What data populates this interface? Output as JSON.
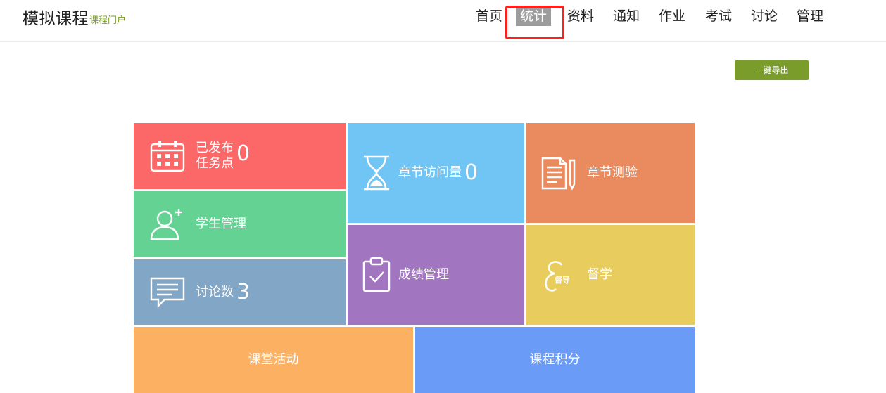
{
  "header": {
    "title": "模拟课程",
    "subtitle": "课程门户"
  },
  "nav": [
    {
      "label": "首页",
      "active": false
    },
    {
      "label": "统计",
      "active": true
    },
    {
      "label": "资料",
      "active": false
    },
    {
      "label": "通知",
      "active": false
    },
    {
      "label": "作业",
      "active": false
    },
    {
      "label": "考试",
      "active": false
    },
    {
      "label": "讨论",
      "active": false
    },
    {
      "label": "管理",
      "active": false
    }
  ],
  "toolbar": {
    "export_label": "一键导出"
  },
  "tiles": {
    "published": {
      "label_line1": "已发布",
      "label_line2": "任务点",
      "count": "0",
      "icon": "calendar-icon",
      "color": "#fc6767"
    },
    "students": {
      "label": "学生管理",
      "icon": "add-user-icon",
      "color": "#64d293"
    },
    "discussions": {
      "label": "讨论数",
      "count": "3",
      "icon": "chat-icon",
      "color": "#82a6c6"
    },
    "chapter_visits": {
      "label": "章节访问量",
      "count": "0",
      "icon": "hourglass-icon",
      "color": "#70c5f5"
    },
    "chapter_quiz": {
      "label": "章节测验",
      "icon": "document-pen-icon",
      "color": "#ea8a5f"
    },
    "grades": {
      "label": "成绩管理",
      "icon": "clipboard-check-icon",
      "color": "#a175bf"
    },
    "supervise": {
      "label": "督学",
      "icon_text": "督导",
      "icon": "supervise-icon",
      "color": "#e8cd5e"
    },
    "activities": {
      "label": "课堂活动",
      "color": "#fbb062"
    },
    "points": {
      "label": "课程积分",
      "color": "#6a9bf6"
    }
  }
}
